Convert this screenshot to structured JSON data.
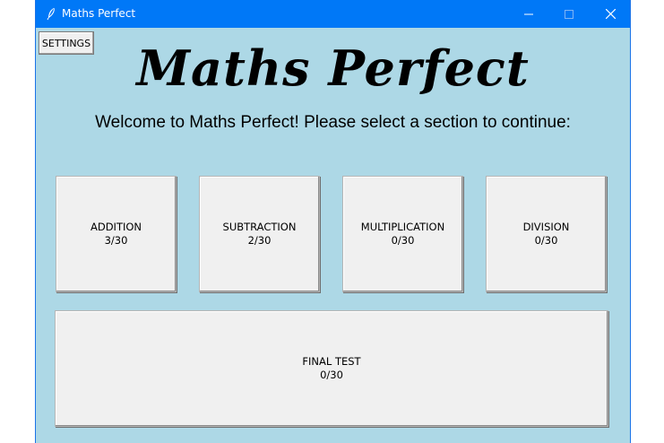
{
  "window": {
    "title": "Maths Perfect",
    "icon": "feather-icon",
    "background_color": "#add8e6",
    "titlebar_color": "#0078f7"
  },
  "toolbar": {
    "settings_label": "SETTINGS"
  },
  "main": {
    "heading": "Maths Perfect",
    "welcome": "Welcome to Maths Perfect! Please select a section to continue:"
  },
  "sections": [
    {
      "label": "ADDITION",
      "score": "3/30"
    },
    {
      "label": "SUBTRACTION",
      "score": "2/30"
    },
    {
      "label": "MULTIPLICATION",
      "score": "0/30"
    },
    {
      "label": "DIVISION",
      "score": "0/30"
    }
  ],
  "final_test": {
    "label": "FINAL TEST",
    "score": "0/30"
  }
}
